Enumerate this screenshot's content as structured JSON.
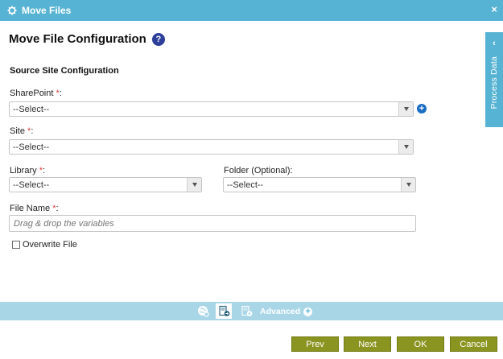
{
  "window": {
    "title": "Move Files",
    "close_symbol": "×"
  },
  "header": {
    "title": "Move File Configuration",
    "help_symbol": "?"
  },
  "section": {
    "title": "Source Site Configuration"
  },
  "fields": {
    "sharepoint": {
      "label": "SharePoint",
      "required": "*",
      "colon": ":",
      "value": "--Select--"
    },
    "site": {
      "label": "Site",
      "required": "*",
      "colon": ":",
      "value": "--Select--"
    },
    "library": {
      "label": "Library",
      "required": "*",
      "colon": ":",
      "value": "--Select--"
    },
    "folder": {
      "label": "Folder (Optional):",
      "value": "--Select--"
    },
    "file_name": {
      "label": "File Name",
      "required": "*",
      "colon": ":",
      "placeholder": "Drag & drop the variables"
    },
    "overwrite": {
      "label": "Overwrite File",
      "checked": false
    }
  },
  "side_panel": {
    "label": "Process Data",
    "arrow": "‹"
  },
  "tabs": {
    "advanced_label": "Advanced",
    "plus": "+"
  },
  "buttons": {
    "prev": "Prev",
    "next": "Next",
    "ok": "OK",
    "cancel": "Cancel"
  },
  "colors": {
    "header_blue": "#57b3d3",
    "tabbar_blue": "#a8d6e7",
    "button_olive": "#8a9420",
    "help_blue": "#2e3f9b",
    "add_blue": "#1b6cc3",
    "required_red": "#e23b3b"
  }
}
